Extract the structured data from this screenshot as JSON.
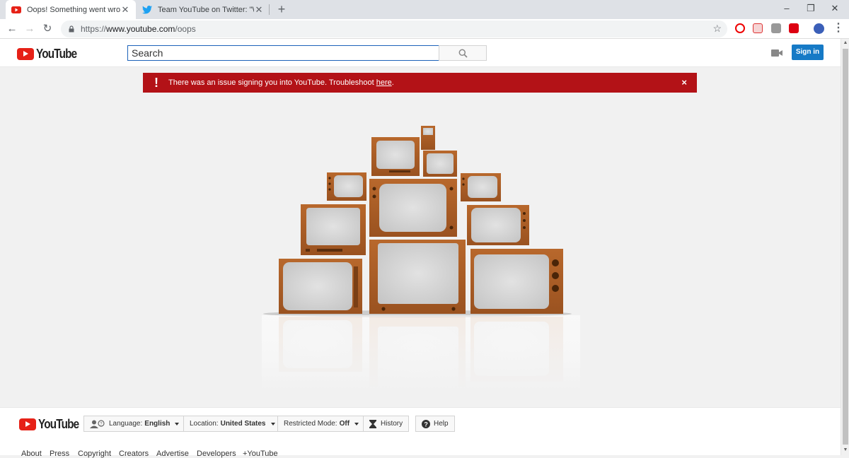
{
  "browser": {
    "tabs": [
      {
        "title": "Oops! Something went wrong. -",
        "active": true
      },
      {
        "title": "Team YouTube on Twitter: \"We'd",
        "active": false
      }
    ],
    "url_prefix": "https://",
    "url_domain": "www.youtube.com",
    "url_path": "/oops"
  },
  "header": {
    "logo_text": "YouTube",
    "search_placeholder": "Search",
    "signin_label": "Sign in"
  },
  "alert": {
    "message": "There was an issue signing you into YouTube. Troubleshoot ",
    "link_text": "here",
    "suffix": ".",
    "close": "×"
  },
  "footer": {
    "logo_text": "YouTube",
    "language_label": "Language:",
    "language_value": "English",
    "location_label": "Location:",
    "location_value": "United States",
    "restricted_label": "Restricted Mode:",
    "restricted_value": "Off",
    "history_label": "History",
    "help_label": "Help",
    "links": [
      "About",
      "Press",
      "Copyright",
      "Creators",
      "Advertise",
      "Developers",
      "+YouTube"
    ]
  },
  "colors": {
    "brand_red": "#e62117",
    "alert_red": "#b31217",
    "signin_blue": "#167ac6",
    "search_border": "#1c62b9"
  }
}
